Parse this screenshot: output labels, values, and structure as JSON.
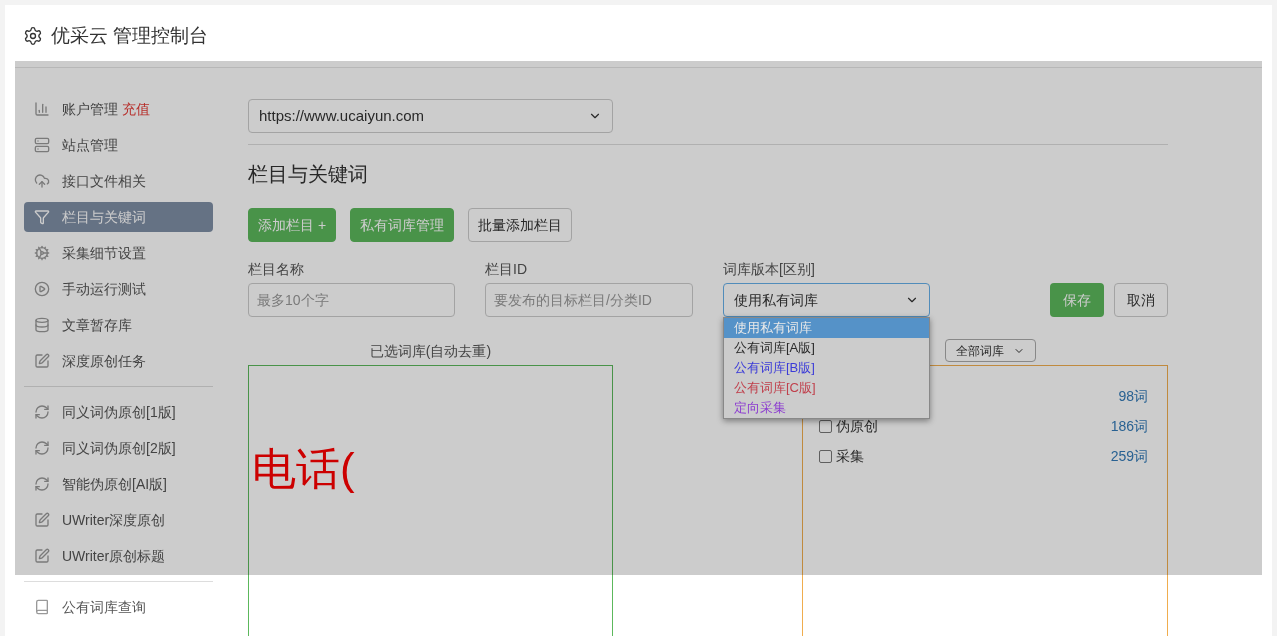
{
  "header": {
    "title": "优采云 管理控制台"
  },
  "sidebar": {
    "groups": [
      {
        "items": [
          {
            "label": "账户管理",
            "badge": "充值",
            "selected": false
          },
          {
            "label": "站点管理",
            "selected": false
          },
          {
            "label": "接口文件相关",
            "selected": false
          },
          {
            "label": "栏目与关键词",
            "selected": true
          },
          {
            "label": "采集细节设置",
            "selected": false
          },
          {
            "label": "手动运行测试",
            "selected": false
          },
          {
            "label": "文章暂存库",
            "selected": false
          },
          {
            "label": "深度原创任务",
            "selected": false
          }
        ]
      },
      {
        "items": [
          {
            "label": "同义词伪原创[1版]",
            "selected": false
          },
          {
            "label": "同义词伪原创[2版]",
            "selected": false
          },
          {
            "label": "智能伪原创[AI版]",
            "selected": false
          },
          {
            "label": "UWriter深度原创",
            "selected": false
          },
          {
            "label": "UWriter原创标题",
            "selected": false
          }
        ]
      },
      {
        "items": [
          {
            "label": "公有词库查询",
            "selected": false
          }
        ]
      }
    ]
  },
  "site_select": {
    "value": "https://www.ucaiyun.com"
  },
  "section_title": "栏目与关键词",
  "buttons": [
    {
      "label": "添加栏目 +",
      "kind": "primary"
    },
    {
      "label": "私有词库管理",
      "kind": "primary"
    },
    {
      "label": "批量添加栏目",
      "kind": "default"
    }
  ],
  "form": {
    "name": {
      "label": "栏目名称",
      "placeholder": "最多10个字"
    },
    "id": {
      "label": "栏目ID",
      "placeholder": "要发布的目标栏目/分类ID"
    },
    "version": {
      "label": "词库版本[区别]",
      "value": "使用私有词库",
      "expanded": true,
      "options": [
        {
          "label": "使用私有词库",
          "selected": true,
          "color": "#e8e8e8"
        },
        {
          "label": "公有词库[A版]",
          "selected": false,
          "color": "#2a2a2a"
        },
        {
          "label": "公有词库[B版]",
          "selected": false,
          "color": "#3c3cd8"
        },
        {
          "label": "公有词库[C版]",
          "selected": false,
          "color": "#c0404c"
        },
        {
          "label": "定向采集",
          "selected": false,
          "color": "#8c3cd0"
        }
      ]
    },
    "save": "保存",
    "cancel": "取消"
  },
  "selected_panel": {
    "title": "已选词库(自动去重)",
    "content": "电话("
  },
  "library_panel": {
    "filter": "全部词库",
    "rows": [
      {
        "count": "98词"
      },
      {
        "label": "伪原创",
        "count": "186词",
        "checked": false
      },
      {
        "label": "采集",
        "count": "259词",
        "checked": false
      }
    ]
  }
}
